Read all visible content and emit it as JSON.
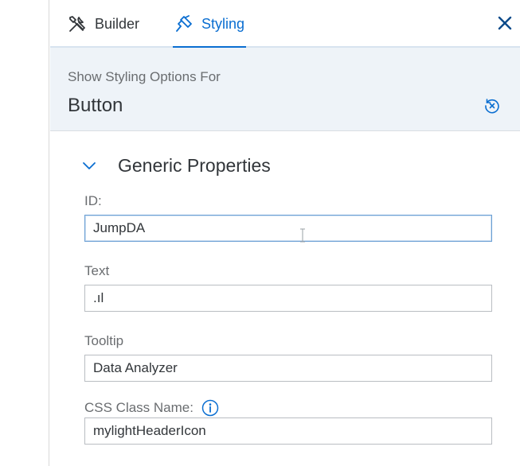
{
  "tabs": {
    "builder_label": "Builder",
    "styling_label": "Styling",
    "active": "Styling"
  },
  "header": {
    "subtitle": "Show Styling Options For",
    "title": "Button"
  },
  "section": {
    "title": "Generic Properties",
    "expanded": true
  },
  "fields": {
    "id": {
      "label": "ID:",
      "value": "JumpDA"
    },
    "text": {
      "label": "Text",
      "value": ".ıl"
    },
    "tooltip": {
      "label": "Tooltip",
      "value": "Data Analyzer"
    },
    "css_class": {
      "label": "CSS Class Name:",
      "value": "mylightHeaderIcon"
    }
  },
  "icons": {
    "builder": "tools-icon",
    "styling": "paint-brush-icon",
    "close": "close-icon",
    "reset": "reset-icon",
    "chevron": "chevron-down-icon",
    "info": "info-icon"
  },
  "colors": {
    "accent": "#0a6ed1",
    "header_bg": "#eef3f8",
    "text": "#32363a",
    "label": "#6a6d70"
  }
}
